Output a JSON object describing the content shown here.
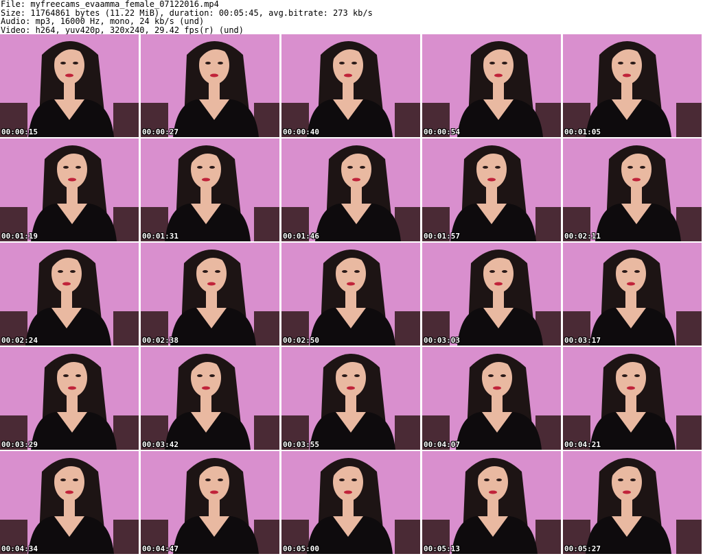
{
  "header": {
    "file_line": "File: myfreecams_evaamma_female_07122016.mp4",
    "size_line": "Size: 11764861 bytes (11.22 MiB), duration: 00:05:45, avg.bitrate: 273 kb/s",
    "audio_line": "Audio: mp3, 16000 Hz, mono, 24 kb/s (und)",
    "video_line": "Video: h264, yuv420p, 320x240, 29.42 fps(r) (und)"
  },
  "thumbnails": [
    {
      "timestamp": "00:00:15"
    },
    {
      "timestamp": "00:00:27"
    },
    {
      "timestamp": "00:00:40"
    },
    {
      "timestamp": "00:00:54"
    },
    {
      "timestamp": "00:01:05"
    },
    {
      "timestamp": "00:01:19"
    },
    {
      "timestamp": "00:01:31"
    },
    {
      "timestamp": "00:01:46"
    },
    {
      "timestamp": "00:01:57"
    },
    {
      "timestamp": "00:02:11"
    },
    {
      "timestamp": "00:02:24"
    },
    {
      "timestamp": "00:02:38"
    },
    {
      "timestamp": "00:02:50"
    },
    {
      "timestamp": "00:03:03"
    },
    {
      "timestamp": "00:03:17"
    },
    {
      "timestamp": "00:03:29"
    },
    {
      "timestamp": "00:03:42"
    },
    {
      "timestamp": "00:03:55"
    },
    {
      "timestamp": "00:04:07"
    },
    {
      "timestamp": "00:04:21"
    },
    {
      "timestamp": "00:04:34"
    },
    {
      "timestamp": "00:04:47"
    },
    {
      "timestamp": "00:05:00"
    },
    {
      "timestamp": "00:05:13"
    },
    {
      "timestamp": "00:05:27"
    }
  ],
  "colors": {
    "background_wall": "#d98fce",
    "hair": "#1d1414",
    "skin": "#e9b9a1",
    "top": "#0e0b0d",
    "lips": "#c0233a"
  }
}
